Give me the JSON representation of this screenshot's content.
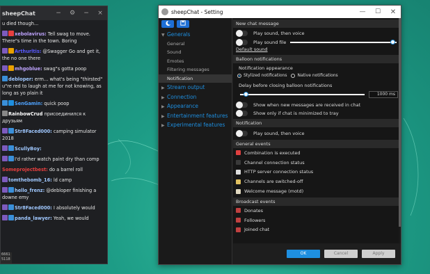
{
  "colors": {
    "accent": "#1e8fe0",
    "desktop": "#1d9c86"
  },
  "chat": {
    "title": "sheepChat",
    "controls": [
      "−",
      "⚙",
      "−",
      "×"
    ],
    "messages": [
      {
        "nick": "",
        "text": "u died though...",
        "nick_color": "#ffffff"
      },
      {
        "nick": "xebolavirus:",
        "text": "Tell swag to move. There\"s time in the town. Boring",
        "nick_color": "#bfa4ff",
        "badges": [
          "#7d5bbe",
          "#e83f3f"
        ]
      },
      {
        "nick": "Arthurltis:",
        "text": "@Swagger Go and get it, the no one there",
        "nick_color": "#5a5aff",
        "badges": [
          "#7d5bbe",
          "#e8a000"
        ]
      },
      {
        "nick": "mhgoblue:",
        "text": "swag\"s gotta poop",
        "nick_color": "#bfa4ff",
        "badges": [
          "#7d5bbe",
          "#e8a000"
        ]
      },
      {
        "nick": "debloper:",
        "text": "erm… what's being \"thirsted\" u\"re red to laugh at me for not knowing, as long as yo plain it",
        "nick_color": "#a0c8ff",
        "badges": [
          "#3a8fd9"
        ]
      },
      {
        "nick": "SenGamin:",
        "text": "quick poop",
        "nick_color": "#4fa3ff",
        "badges": [
          "#3a8fd9",
          "#1e8fe0"
        ]
      },
      {
        "nick": "RainbowCrud",
        "text": "присоединился к друзьям",
        "nick_color": "#ffffff",
        "badges": [
          "#888888"
        ]
      },
      {
        "nick": "Str8Faced000:",
        "text": "camping simulator 2018",
        "nick_color": "#a0c8ff",
        "badges": [
          "#7d5bbe",
          "#3a8fd9"
        ]
      },
      {
        "nick": "ScullyBoy:",
        "text": "",
        "nick_color": "#a0c8ff",
        "badges": [
          "#7d5bbe",
          "#3a8fd9"
        ]
      },
      {
        "nick": "",
        "text": "I'd rather watch paint dry than comp",
        "nick_color": "#7d5bbe",
        "badges": [
          "#7d5bbe",
          "#3a8fd9"
        ]
      },
      {
        "nick": "Someprojectbest:",
        "text": "do a barrel roll",
        "nick_color": "#e83f3f",
        "badges": []
      },
      {
        "nick": "tomthebomb_16:",
        "text": "ld camp",
        "nick_color": "#a0c8ff",
        "badges": [
          "#7d5bbe"
        ]
      },
      {
        "nick": "hello_frenz:",
        "text": "@debloper finishing a downe emy",
        "nick_color": "#a0c8ff",
        "badges": [
          "#7d5bbe",
          "#3a8fd9"
        ]
      },
      {
        "nick": "Str8Faced000:",
        "text": "I absolutely would",
        "nick_color": "#a0c8ff",
        "badges": [
          "#7d5bbe",
          "#3a8fd9"
        ]
      },
      {
        "nick": "panda_lawyer:",
        "text": "Yeah, we would",
        "nick_color": "#a0c8ff",
        "badges": [
          "#7d5bbe",
          "#3a8fd9"
        ]
      }
    ],
    "footer_lines": [
      "6661",
      "5118"
    ]
  },
  "settings": {
    "title": "sheepChat - Setting",
    "controls": [
      "—",
      "☐",
      "✕"
    ],
    "tree": [
      {
        "label": "Generals",
        "open": true,
        "children": [
          "General",
          "Sound",
          "Emotes",
          "Filtering messages",
          "Notification"
        ]
      },
      {
        "label": "Stream output"
      },
      {
        "label": "Connection"
      },
      {
        "label": "Appearance"
      },
      {
        "label": "Entertainment features"
      },
      {
        "label": "Experimental features"
      }
    ],
    "new_chat": {
      "header": "New chat message",
      "opt1": "Play sound, then voice",
      "opt2": "Play sound file",
      "slider_pct": 97,
      "default_sound": "Default sound"
    },
    "balloon": {
      "header": "Balloon notifications",
      "appearance_label": "Notification appearance",
      "radio_on": "Stylized notifications",
      "radio_off": "Native notifications",
      "delay_label": "Delay before closing balloon notifications",
      "delay_value": "1000 ms",
      "delay_slider_pct": 5,
      "opt_received": "Show when new messages are received in chat",
      "opt_minimized": "Show only if chat is minimized to tray"
    },
    "notification": {
      "header": "Notification",
      "opt": "Play sound, then voice"
    },
    "general_events": {
      "header": "General events",
      "items": [
        {
          "label": "Combination is executed",
          "icon": "combo-icon",
          "color": "#e04040"
        },
        {
          "label": "Channel connection status",
          "icon": "channel-icon",
          "color": "#3a3a3a"
        },
        {
          "label": "HTTP server connection status",
          "icon": "server-icon",
          "color": "#dddddd"
        },
        {
          "label": "Channels are switched-off",
          "icon": "switch-icon",
          "color": "#e0c060"
        },
        {
          "label": "Welcome message (motd)",
          "icon": "note-icon",
          "color": "#e0d8c0"
        }
      ]
    },
    "broadcast_events": {
      "header": "Broadcast events",
      "items": [
        {
          "label": "Donates",
          "icon": "donate-icon",
          "color": "#c04040"
        },
        {
          "label": "Followers",
          "icon": "follower-icon",
          "color": "#c04040"
        },
        {
          "label": "Joined chat",
          "icon": "join-icon",
          "color": "#c04040"
        }
      ]
    },
    "buttons": {
      "ok": "OK",
      "cancel": "Cancel",
      "apply": "Apply"
    }
  }
}
